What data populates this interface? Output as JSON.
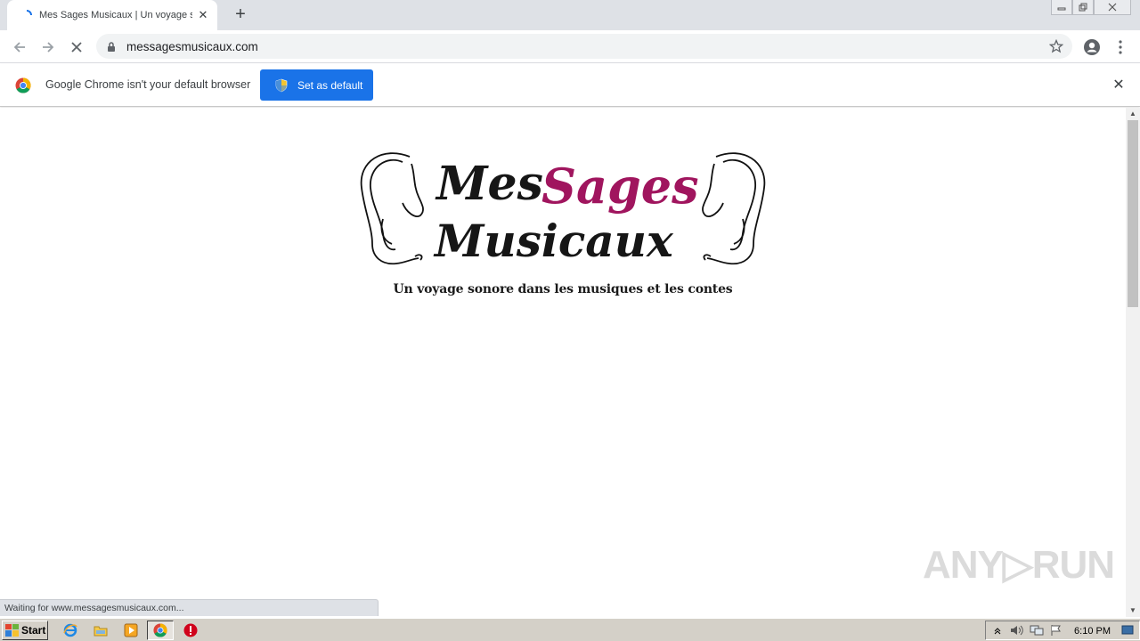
{
  "browser": {
    "tab": {
      "title": "Mes Sages Musicaux | Un voyage so",
      "close": "✕"
    },
    "new_tab": "+",
    "address": "messagesmusicaux.com",
    "infobar": {
      "message": "Google Chrome isn't your default browser",
      "button_label": "Set as default",
      "close": "✕"
    },
    "status_text": "Waiting for www.messagesmusicaux.com..."
  },
  "page": {
    "logo_line1_a": "Mes",
    "logo_line1_b": "Sages",
    "logo_line2": "Musicaux",
    "tagline": "Un voyage sonore dans les musiques et les contes",
    "watermark": "ANY▷RUN"
  },
  "taskbar": {
    "start_label": "Start",
    "clock": "6:10 PM",
    "pinned": [
      "ie-icon",
      "explorer-icon",
      "media-player-icon",
      "chrome-icon",
      "stop-icon"
    ]
  },
  "colors": {
    "accent": "#1a73e8",
    "logo_magenta": "#a0155e",
    "tabstrip": "#dee1e6"
  }
}
